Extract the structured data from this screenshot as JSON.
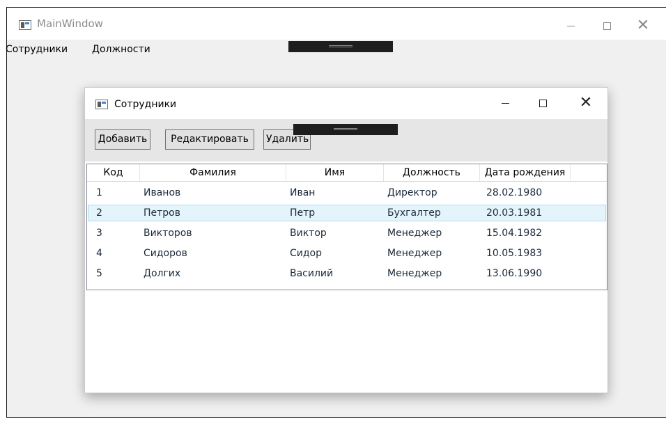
{
  "main_window": {
    "title": "MainWindow",
    "caption": {
      "minimize": "—",
      "maximize": "☐",
      "close": "✕"
    },
    "menu": [
      "Сотрудники",
      "Должности"
    ]
  },
  "child_window": {
    "title": "Сотрудники",
    "caption": {
      "minimize": "—",
      "maximize": "☐",
      "close": "✕"
    },
    "toolbar": {
      "add_label": "Добавить",
      "edit_label": "Редактировать",
      "delete_label": "Удалить"
    }
  },
  "grid": {
    "columns": [
      "Код",
      "Фамилия",
      "Имя",
      "Должность",
      "Дата рождения"
    ],
    "selected_row": 1,
    "rows": [
      [
        "1",
        "Иванов",
        "Иван",
        "Директор",
        "28.02.1980"
      ],
      [
        "2",
        "Петров",
        "Петр",
        "Бухгалтер",
        "20.03.1981"
      ],
      [
        "3",
        "Викторов",
        "Виктор",
        "Менеджер",
        "15.04.1982"
      ],
      [
        "4",
        "Сидоров",
        "Сидор",
        "Менеджер",
        "10.05.1983"
      ],
      [
        "5",
        "Долгих",
        "Василий",
        "Менеджер",
        "13.06.1990"
      ]
    ]
  },
  "colors": {
    "selection_bg": "#e5f3fb",
    "selection_border": "#abdcf8",
    "toolbar_bg": "#e6e6e6",
    "window_bg": "#f0f0f0"
  }
}
